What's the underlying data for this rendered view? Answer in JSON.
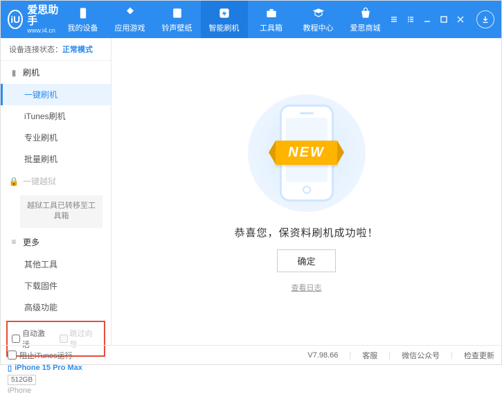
{
  "header": {
    "logo_title": "爱思助手",
    "logo_url": "www.i4.cn",
    "nav": [
      {
        "label": "我的设备"
      },
      {
        "label": "应用游戏"
      },
      {
        "label": "铃声壁纸"
      },
      {
        "label": "智能刷机"
      },
      {
        "label": "工具箱"
      },
      {
        "label": "教程中心"
      },
      {
        "label": "爱思商城"
      }
    ]
  },
  "sidebar": {
    "status_label": "设备连接状态：",
    "status_mode": "正常模式",
    "groups": {
      "flash": "刷机",
      "jailbreak": "一键越狱",
      "more": "更多"
    },
    "items": {
      "onekey": "一键刷机",
      "itunes": "iTunes刷机",
      "pro": "专业刷机",
      "batch": "批量刷机",
      "jb_note": "越狱工具已转移至工具箱",
      "other_tools": "其他工具",
      "download_fw": "下载固件",
      "advanced": "高级功能"
    },
    "checks": {
      "auto_activate": "自动激活",
      "skip_guide": "跳过向导"
    },
    "device": {
      "name": "iPhone 15 Pro Max",
      "storage": "512GB",
      "type": "iPhone"
    }
  },
  "main": {
    "ribbon": "NEW",
    "success": "恭喜您，保资料刷机成功啦！",
    "ok": "确定",
    "log": "查看日志"
  },
  "statusbar": {
    "block_itunes": "阻止iTunes运行",
    "version": "V7.98.66",
    "service": "客服",
    "wechat": "微信公众号",
    "update": "检查更新"
  }
}
